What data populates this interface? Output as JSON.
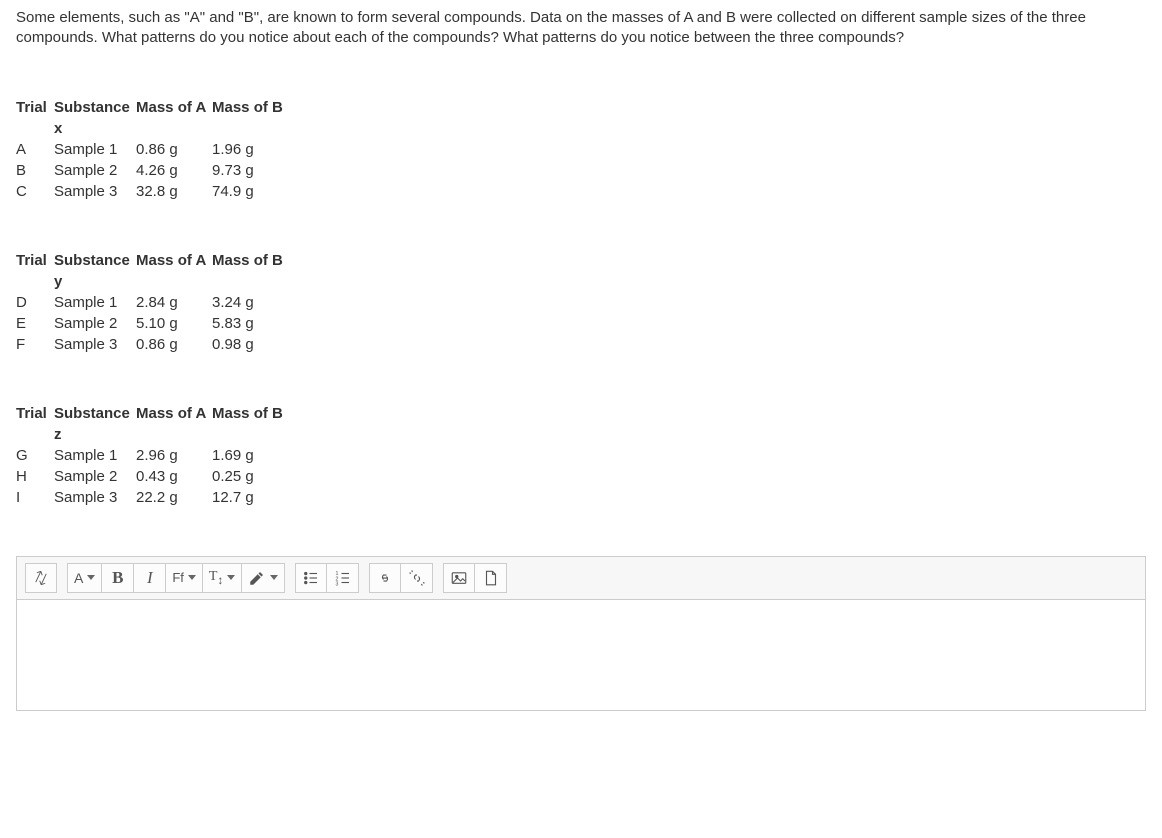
{
  "question": "Some elements, such as \"A\" and \"B\", are known to form several compounds.  Data on the masses of A and B were collected on different sample sizes of the three compounds.  What patterns do you notice about each of the compounds? What patterns do you notice between the three compounds?",
  "headers": {
    "trial": "Trial",
    "massA": "Mass of A",
    "massB": "Mass of B"
  },
  "substances": [
    {
      "name": "Substance x",
      "rows": [
        {
          "trial": "A",
          "sample": "Sample 1",
          "massA": "0.86 g",
          "massB": "1.96 g"
        },
        {
          "trial": "B",
          "sample": "Sample 2",
          "massA": "4.26 g",
          "massB": "9.73 g"
        },
        {
          "trial": "C",
          "sample": "Sample 3",
          "massA": "32.8 g",
          "massB": "74.9 g"
        }
      ]
    },
    {
      "name": "Substance y",
      "rows": [
        {
          "trial": "D",
          "sample": "Sample 1",
          "massA": "2.84 g",
          "massB": "3.24 g"
        },
        {
          "trial": "E",
          "sample": "Sample 2",
          "massA": "5.10 g",
          "massB": "5.83 g"
        },
        {
          "trial": "F",
          "sample": "Sample 3",
          "massA": "0.86 g",
          "massB": "0.98 g"
        }
      ]
    },
    {
      "name": "Substance z",
      "rows": [
        {
          "trial": "G",
          "sample": "Sample 1",
          "massA": "2.96 g",
          "massB": "1.69 g"
        },
        {
          "trial": "H",
          "sample": "Sample 2",
          "massA": "0.43 g",
          "massB": "0.25 g"
        },
        {
          "trial": "I",
          "sample": "Sample 3",
          "massA": "22.2 g",
          "massB": "12.7 g"
        }
      ]
    }
  ],
  "toolbar": {
    "fontChar": "A",
    "bold": "B",
    "italic": "I",
    "fontFamily": "Ff",
    "textTool": "T"
  }
}
